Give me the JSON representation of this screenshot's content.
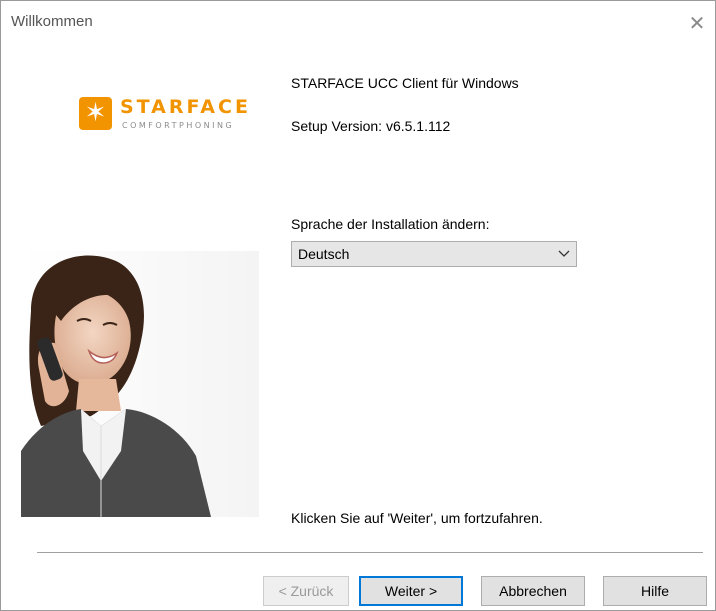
{
  "window": {
    "title": "Willkommen"
  },
  "logo": {
    "brand": "STARFACE",
    "tagline": "COMFORTPHONING",
    "color": "#f29400"
  },
  "info": {
    "product": "STARFACE UCC Client für Windows",
    "version": "Setup Version: v6.5.1.112"
  },
  "language": {
    "label": "Sprache der Installation ändern:",
    "selected": "Deutsch"
  },
  "hint": "Klicken Sie auf 'Weiter', um fortzufahren.",
  "buttons": {
    "back": "< Zurück",
    "next": "Weiter >",
    "cancel": "Abbrechen",
    "help": "Hilfe"
  },
  "icons": {
    "close": "close-icon",
    "dropdown": "chevron-down-icon",
    "logo": "star-icon"
  }
}
